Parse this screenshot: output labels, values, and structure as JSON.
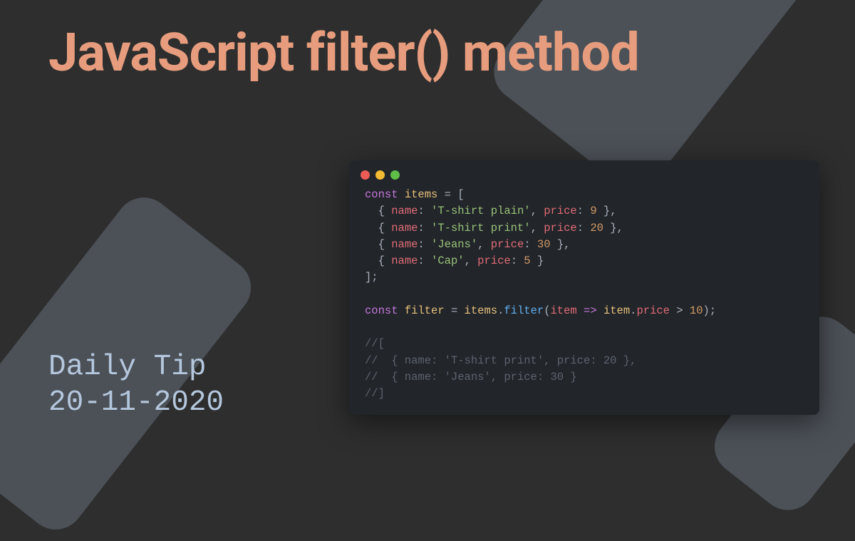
{
  "title": "JavaScript filter() method",
  "subtitle_line1": "Daily Tip",
  "subtitle_line2": "20-11-2020",
  "code": {
    "kw_const1": "const",
    "var_items": "items",
    "eq1": " = [",
    "row1_open": "  { ",
    "row1_name_key": "name",
    "row1_name_val": "'T-shirt plain'",
    "row1_price_key": "price",
    "row1_price_val": "9",
    "row1_close": " },",
    "row2_name_val": "'T-shirt print'",
    "row2_price_val": "20",
    "row3_name_val": "'Jeans'",
    "row3_price_val": "30",
    "row4_name_val": "'Cap'",
    "row4_price_val": "5",
    "row4_close": " }",
    "arr_close": "];",
    "kw_const2": "const",
    "var_filter": "filter",
    "eq2": " = ",
    "items_ref": "items",
    "dot": ".",
    "fn_filter": "filter",
    "paren_open": "(",
    "param_item": "item",
    "arrow": " => ",
    "item_ref": "item",
    "price_prop": "price",
    "gt": " > ",
    "ten": "10",
    "paren_close": ");",
    "comment1": "//[",
    "comment2": "//  { name: 'T-shirt print', price: 20 },",
    "comment3": "//  { name: 'Jeans', price: 30 }",
    "comment4": "//]",
    "colon_sep": ": ",
    "comma_sep": ", "
  }
}
